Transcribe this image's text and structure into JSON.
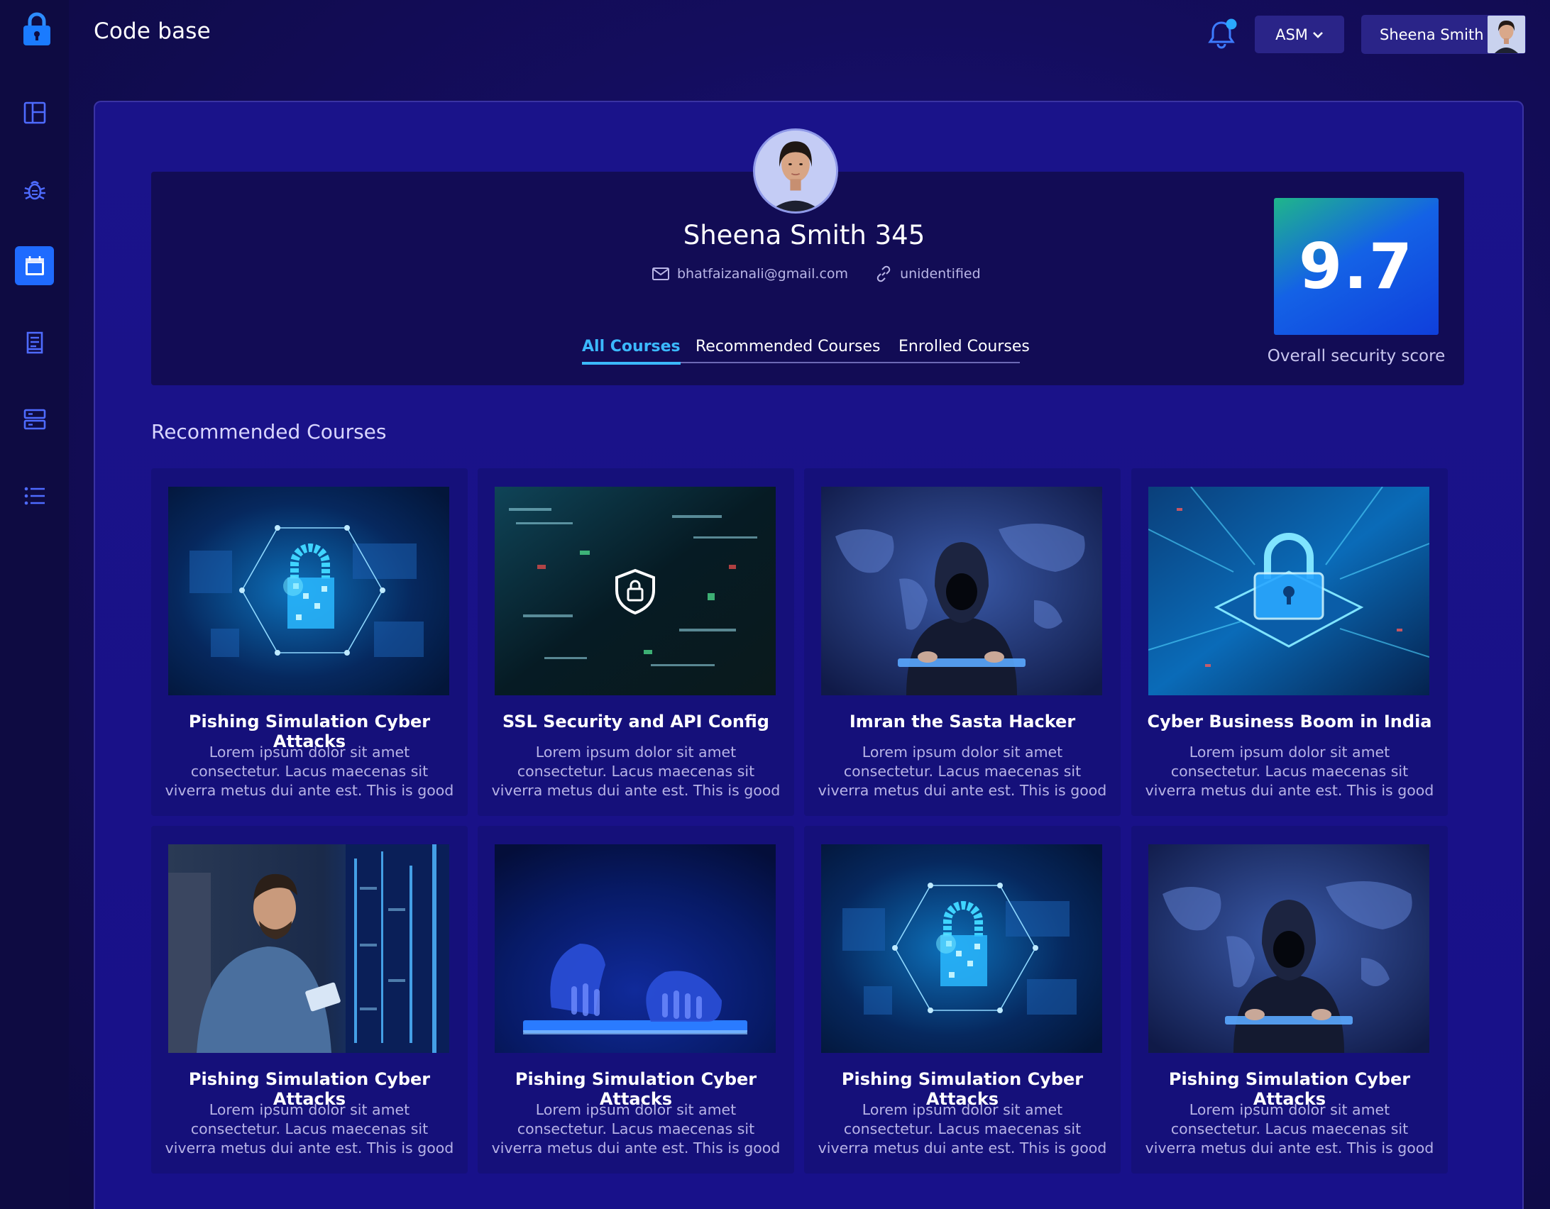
{
  "app": {
    "title": "Code base"
  },
  "sidebar": {
    "items": [
      {
        "icon": "layout-dashboard-icon"
      },
      {
        "icon": "bug-icon"
      },
      {
        "icon": "calendar-icon",
        "active": true
      },
      {
        "icon": "document-icon"
      },
      {
        "icon": "server-icon"
      },
      {
        "icon": "list-icon"
      }
    ]
  },
  "header": {
    "org_selector": "ASM",
    "user_name": "Sheena Smith",
    "notification_dot_color": "#2aa8ff"
  },
  "profile": {
    "name": "Sheena  Smith 345",
    "email": "bhatfaizanali@gmail.com",
    "link": "unidentified"
  },
  "tabs": [
    {
      "label": "All Courses",
      "active": true
    },
    {
      "label": "Recommended Courses"
    },
    {
      "label": "Enrolled Courses"
    }
  ],
  "score": {
    "value": "9.7",
    "label": "Overall security score"
  },
  "section": {
    "title": "Recommended Courses"
  },
  "courses": [
    {
      "title": "Pishing Simulation Cyber Attacks",
      "desc": "Lorem ipsum dolor sit amet consectetur. Lacus maecenas sit viverra metus dui ante est. This is good",
      "image": "padlock-network"
    },
    {
      "title": "SSL Security and API Config",
      "desc": "Lorem ipsum dolor sit amet consectetur. Lacus maecenas sit viverra metus dui ante est. This is good",
      "image": "shield-circuit"
    },
    {
      "title": "Imran the Sasta Hacker",
      "desc": "Lorem ipsum dolor sit amet consectetur. Lacus maecenas sit viverra metus dui ante est. This is good",
      "image": "hooded-hacker"
    },
    {
      "title": "Cyber Business Boom in India",
      "desc": "Lorem ipsum dolor sit amet consectetur. Lacus maecenas sit viverra metus dui ante est. This is good",
      "image": "chip-padlock"
    },
    {
      "title": "Pishing Simulation Cyber Attacks",
      "desc": "Lorem ipsum dolor sit amet consectetur. Lacus maecenas sit viverra metus dui ante est. This is good",
      "image": "server-technician"
    },
    {
      "title": "Pishing Simulation Cyber Attacks",
      "desc": "Lorem ipsum dolor sit amet consectetur. Lacus maecenas sit viverra metus dui ante est. This is good",
      "image": "hands-keyboard"
    },
    {
      "title": "Pishing Simulation Cyber Attacks",
      "desc": "Lorem ipsum dolor sit amet consectetur. Lacus maecenas sit viverra metus dui ante est. This is good",
      "image": "padlock-network"
    },
    {
      "title": "Pishing Simulation Cyber Attacks",
      "desc": "Lorem ipsum dolor sit amet consectetur. Lacus maecenas sit viverra metus dui ante est. This is good",
      "image": "hooded-hacker"
    }
  ]
}
